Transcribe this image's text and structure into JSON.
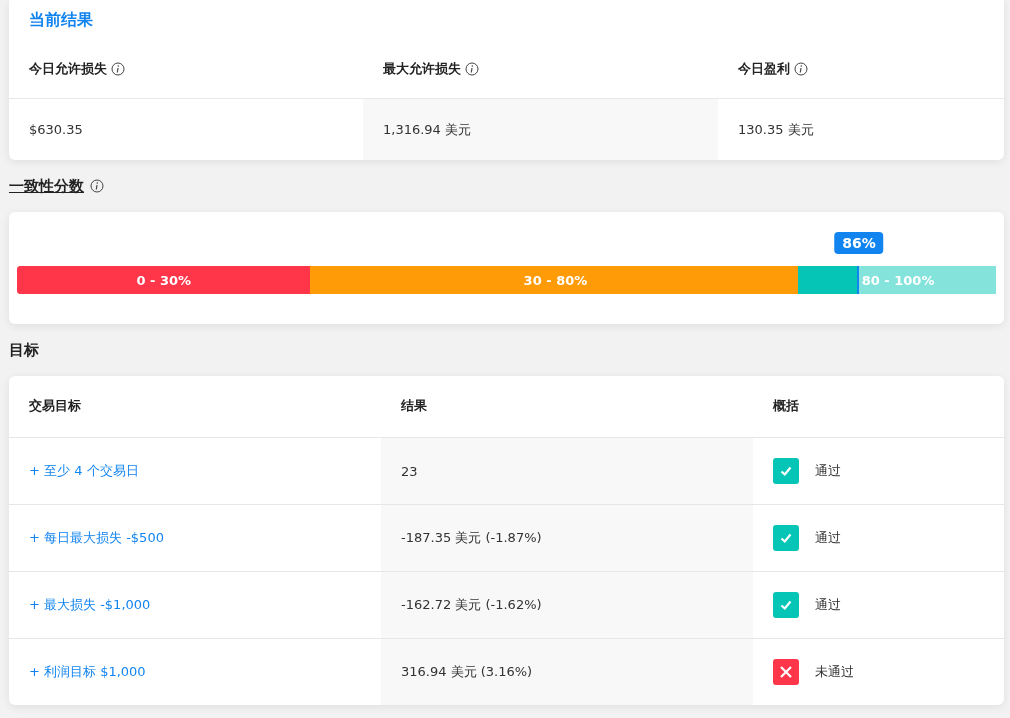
{
  "current_results": {
    "title": "当前结果",
    "columns": [
      {
        "label": "今日允许损失",
        "value": "$630.35"
      },
      {
        "label": "最大允许损失",
        "value": "1,316.94 美元"
      },
      {
        "label": "今日盈利",
        "value": "130.35 美元"
      }
    ]
  },
  "consistency": {
    "title": "一致性分数",
    "level": 0.86,
    "reading": "86%",
    "ranges": [
      {
        "label": "0 - 30%",
        "color": "#ff3549"
      },
      {
        "label": "30 - 80%",
        "color": "#ff9b07"
      },
      {
        "label": "80 - 100%",
        "color": "#84e3db"
      }
    ]
  },
  "objectives": {
    "title": "目标",
    "columns": [
      "交易目标",
      "结果",
      "概括"
    ],
    "rows": [
      {
        "objective": "+ 至少 4 个交易日",
        "result": "23",
        "passed": true,
        "summary": "通过"
      },
      {
        "objective": "+ 每日最大损失 -$500",
        "result": "-187.35 美元 (-1.87%)",
        "passed": true,
        "summary": "通过"
      },
      {
        "objective": "+ 最大损失 -$1,000",
        "result": "-162.72 美元 (-1.62%)",
        "passed": true,
        "summary": "通过"
      },
      {
        "objective": "+ 利润目标 $1,000",
        "result": "316.94 美元 (3.16%)",
        "passed": false,
        "summary": "未通过"
      }
    ]
  }
}
